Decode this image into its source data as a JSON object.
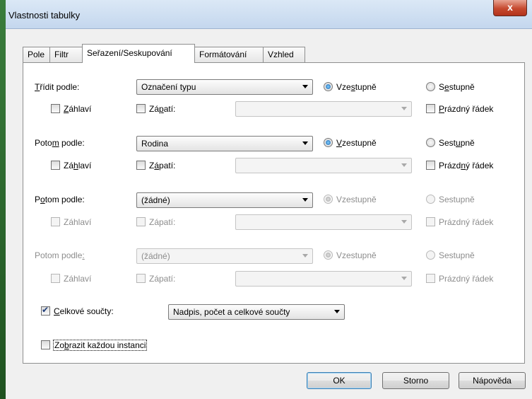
{
  "window": {
    "title": "Vlastnosti tabulky",
    "close_glyph": "x"
  },
  "tabs": [
    {
      "label": "Pole",
      "active": false
    },
    {
      "label": "Filtr",
      "active": false
    },
    {
      "label": "Seřazení/Seskupování",
      "active": true
    },
    {
      "label": "Formátování",
      "active": false
    },
    {
      "label": "Vzhled",
      "active": false
    }
  ],
  "sort_rows": [
    {
      "label_pre": "",
      "label_u": "T",
      "label_post": "řídit podle:",
      "dropdown": "Označení typu",
      "asc": {
        "pre": "Vze",
        "u": "s",
        "post": "tupně"
      },
      "desc": {
        "pre": "S",
        "u": "e",
        "post": "stupně"
      },
      "ascending": true,
      "header": {
        "pre": "",
        "u": "Z",
        "post": "áhlaví"
      },
      "footer": {
        "pre": "Zá",
        "u": "p",
        "post": "atí:"
      },
      "footer_value": "",
      "blank": {
        "pre": "",
        "u": "P",
        "post": "rázdný řádek"
      }
    },
    {
      "label_pre": "Poto",
      "label_u": "m",
      "label_post": " podle:",
      "dropdown": "Rodina",
      "asc": {
        "pre": "",
        "u": "V",
        "post": "zestupně"
      },
      "desc": {
        "pre": "Sest",
        "u": "u",
        "post": "pně"
      },
      "ascending": true,
      "header": {
        "pre": "Zá",
        "u": "h",
        "post": "laví"
      },
      "footer": {
        "pre": "Z",
        "u": "á",
        "post": "patí:"
      },
      "footer_value": "",
      "blank": {
        "pre": "Prázd",
        "u": "n",
        "post": "ý řádek"
      }
    },
    {
      "label_pre": "P",
      "label_u": "o",
      "label_post": "tom podle:",
      "dropdown": "(žádné)",
      "asc": {
        "pre": "Vzestupně",
        "u": "",
        "post": ""
      },
      "desc": {
        "pre": "Sestupně",
        "u": "",
        "post": ""
      },
      "ascending": true,
      "header": {
        "pre": "Záhlaví",
        "u": "",
        "post": ""
      },
      "footer": {
        "pre": "Zápatí:",
        "u": "",
        "post": ""
      },
      "footer_value": "",
      "blank": {
        "pre": "Prázdný řádek",
        "u": "",
        "post": ""
      }
    },
    {
      "label_pre": "Potom podle",
      "label_u": ":",
      "label_post": "",
      "dropdown": "(žádné)",
      "asc": {
        "pre": "Vzestupně",
        "u": "",
        "post": ""
      },
      "desc": {
        "pre": "Sestupně",
        "u": "",
        "post": ""
      },
      "ascending": true,
      "header": {
        "pre": "Záhlaví",
        "u": "",
        "post": ""
      },
      "footer": {
        "pre": "Zápatí:",
        "u": "",
        "post": ""
      },
      "footer_value": "",
      "blank": {
        "pre": "Prázdný řádek",
        "u": "",
        "post": ""
      }
    }
  ],
  "totals": {
    "pre": "",
    "u": "C",
    "post": "elkové součty:",
    "checked": true,
    "dropdown": "Nadpis, počet a celkové součty"
  },
  "show_each": {
    "pre": "Zo",
    "u": "b",
    "post": "razit každou instanci",
    "checked": false
  },
  "buttons": {
    "ok": "OK",
    "cancel": "Storno",
    "help": "Nápověda"
  }
}
